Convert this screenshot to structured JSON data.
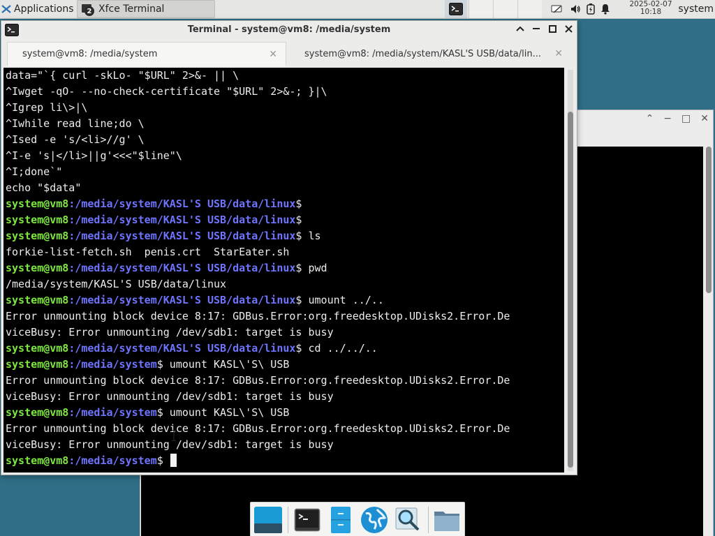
{
  "panel": {
    "applications_label": "Applications",
    "task_label": "Xfce Terminal",
    "task_count": "2",
    "clock_date": "2025-02-07",
    "clock_time": "10:18",
    "user": "system"
  },
  "window": {
    "title": "Terminal - system@vm8: /media/system",
    "tabs": [
      {
        "label": "system@vm8: /media/system"
      },
      {
        "label": "system@vm8: /media/system/KASL'S USB/data/lin..."
      }
    ]
  },
  "terminal": {
    "lines": [
      {
        "t": "data=\"`{ curl -skLo- \"$URL\" 2>&- || \\"
      },
      {
        "t": "^Iwget -qO- --no-check-certificate \"$URL\" 2>&-; }|\\"
      },
      {
        "t": "^Igrep li\\>|\\"
      },
      {
        "t": "^Iwhile read line;do \\"
      },
      {
        "t": "^Ised -e 's/<li>//g' \\"
      },
      {
        "t": "^I-e 's|</li>||g'<<<\"$line\"\\"
      },
      {
        "t": "^I;done`\""
      },
      {
        "t": "echo \"$data\""
      },
      {
        "u": "system@vm8",
        "p": ":/media/system/KASL'S USB/data/linux",
        "c": "$"
      },
      {
        "u": "system@vm8",
        "p": ":/media/system/KASL'S USB/data/linux",
        "c": "$"
      },
      {
        "u": "system@vm8",
        "p": ":/media/system/KASL'S USB/data/linux",
        "c": "$ ls"
      },
      {
        "t": "forkie-list-fetch.sh  penis.crt  StarEater.sh"
      },
      {
        "u": "system@vm8",
        "p": ":/media/system/KASL'S USB/data/linux",
        "c": "$ pwd"
      },
      {
        "t": "/media/system/KASL'S USB/data/linux"
      },
      {
        "u": "system@vm8",
        "p": ":/media/system/KASL'S USB/data/linux",
        "c": "$ umount ../.."
      },
      {
        "t": "Error unmounting block device 8:17: GDBus.Error:org.freedesktop.UDisks2.Error.De"
      },
      {
        "t": "viceBusy: Error unmounting /dev/sdb1: target is busy"
      },
      {
        "u": "system@vm8",
        "p": ":/media/system/KASL'S USB/data/linux",
        "c": "$ cd ../../.."
      },
      {
        "u": "system@vm8",
        "p": ":/media/system",
        "c": "$ umount KASL\\'S\\ USB"
      },
      {
        "t": "Error unmounting block device 8:17: GDBus.Error:org.freedesktop.UDisks2.Error.De"
      },
      {
        "t": "viceBusy: Error unmounting /dev/sdb1: target is busy"
      },
      {
        "u": "system@vm8",
        "p": ":/media/system",
        "c": "$ umount KASL\\'S\\ USB"
      },
      {
        "t": "Error unmounting block device 8:17: GDBus.Error:org.freedesktop.UDisks2.Error.De"
      },
      {
        "t": "viceBusy: Error unmounting /dev/sdb1: target is busy"
      },
      {
        "u": "system@vm8",
        "p": ":/media/system",
        "c": "$ ",
        "cursor": true
      }
    ]
  },
  "colors": {
    "desktop": "#2f6e86",
    "prompt_user": "#7ee83e",
    "prompt_path": "#6f74ff"
  },
  "dock": {
    "icons": [
      "desktop-icon",
      "terminal-icon",
      "file-cabinet-icon",
      "web-browser-icon",
      "search-icon",
      "folder-icon"
    ]
  }
}
